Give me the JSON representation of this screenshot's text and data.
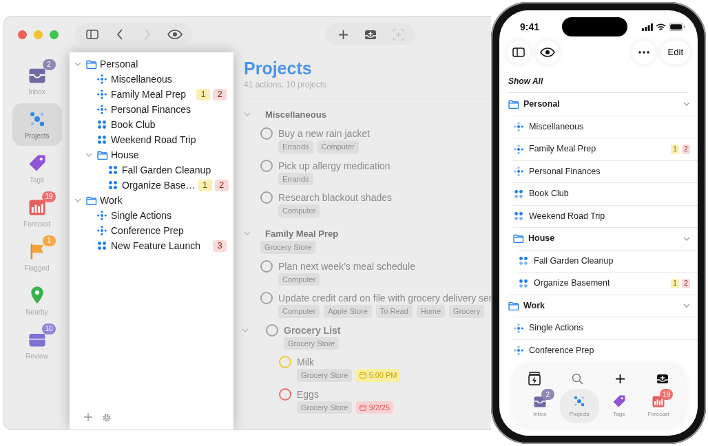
{
  "mac_window": {
    "toolbar": [
      {
        "kind": "sidebar",
        "disabled": false
      },
      {
        "kind": "back",
        "disabled": false
      },
      {
        "kind": "forward",
        "disabled": true
      },
      {
        "kind": "eye",
        "disabled": false
      },
      {
        "kind": "add",
        "disabled": false
      },
      {
        "kind": "inbox_add",
        "disabled": false
      },
      {
        "kind": "capture",
        "disabled": true
      }
    ],
    "rail": [
      {
        "kind": "inbox",
        "label": "Inbox",
        "badge": "2",
        "selected": false
      },
      {
        "kind": "projects",
        "label": "Projects",
        "selected": true
      },
      {
        "kind": "tags",
        "label": "Tags",
        "selected": false
      },
      {
        "kind": "forecast",
        "label": "Forecast",
        "badge": "19",
        "selected": false
      },
      {
        "kind": "flagged",
        "label": "Flagged",
        "badge": "1",
        "selected": false
      },
      {
        "kind": "nearby",
        "label": "Nearby",
        "selected": false
      },
      {
        "kind": "review",
        "label": "Review",
        "badge": "10",
        "selected": false
      }
    ],
    "sidebar": {
      "tree": [
        {
          "kind": "folder",
          "name": "Personal",
          "expanded": true,
          "children": [
            {
              "kind": "cross",
              "name": "Miscellaneous"
            },
            {
              "kind": "cross",
              "name": "Family Meal Prep",
              "due_soon": "1",
              "overdue": "2"
            },
            {
              "kind": "cross",
              "name": "Personal Finances"
            },
            {
              "kind": "grid",
              "name": "Book Club"
            },
            {
              "kind": "grid",
              "name": "Weekend Road Trip"
            },
            {
              "kind": "folder",
              "name": "House",
              "expanded": true,
              "children": [
                {
                  "kind": "grid",
                  "name": "Fall Garden Cleanup"
                },
                {
                  "kind": "grid",
                  "name": "Organize Base…",
                  "due_soon": "1",
                  "overdue": "2"
                }
              ]
            }
          ]
        },
        {
          "kind": "folder",
          "name": "Work",
          "expanded": true,
          "children": [
            {
              "kind": "cross",
              "name": "Single Actions"
            },
            {
              "kind": "cross",
              "name": "Conference Prep"
            },
            {
              "kind": "grid",
              "name": "New Feature Launch",
              "overdue": "3"
            }
          ]
        }
      ]
    },
    "main": {
      "title": "Projects",
      "subtitle": "41 actions, 10 projects",
      "sections": [
        {
          "title": "Miscellaneous",
          "expanded": true,
          "actions": [
            {
              "kind": "action",
              "title": "Buy a new rain jacket",
              "due_soon": false,
              "overdue": false,
              "tags": [
                "Errands",
                "Computer"
              ]
            },
            {
              "kind": "action",
              "title": "Pick up allergy medication",
              "due_soon": false,
              "overdue": false,
              "tags": [
                "Errands"
              ]
            },
            {
              "kind": "action",
              "title": "Research blackout shades",
              "due_soon": false,
              "overdue": false,
              "tags": [
                "Computer"
              ]
            }
          ]
        },
        {
          "title": "Family Meal Prep",
          "expanded": true,
          "tags": [
            "Grocery Store"
          ],
          "actions": [
            {
              "kind": "action",
              "title": "Plan next week’s meal schedule",
              "due_soon": false,
              "overdue": false,
              "tags": [
                "Computer"
              ]
            },
            {
              "kind": "action",
              "title": "Update credit card on file with grocery delivery ser",
              "due_soon": false,
              "overdue": false,
              "tags": [
                "Computer",
                "Apple Store",
                "To Read",
                "Home",
                "Grocery"
              ]
            },
            {
              "kind": "group",
              "title": "Grocery List",
              "due_soon": false,
              "overdue": false,
              "expanded": true,
              "tags": [
                "Grocery Store"
              ],
              "children": [
                {
                  "kind": "action",
                  "title": "Milk",
                  "due_soon": true,
                  "overdue": false,
                  "tags": [
                    "Grocery Store"
                  ],
                  "due": "5:00 PM"
                },
                {
                  "kind": "action",
                  "title": "Eggs",
                  "due_soon": false,
                  "overdue": true,
                  "tags": [
                    "Grocery Store"
                  ],
                  "due": "9/2/25"
                }
              ]
            }
          ]
        }
      ]
    }
  },
  "phone": {
    "status_time": "9:41",
    "edit_label": "Edit",
    "show_all": "Show All",
    "tree": [
      {
        "kind": "folder",
        "name": "Personal",
        "expanded": true,
        "children": [
          {
            "kind": "cross",
            "name": "Miscellaneous"
          },
          {
            "kind": "cross",
            "name": "Family Meal Prep",
            "due_soon": "1",
            "overdue": "2"
          },
          {
            "kind": "cross",
            "name": "Personal Finances"
          },
          {
            "kind": "grid",
            "name": "Book Club"
          },
          {
            "kind": "grid",
            "name": "Weekend Road Trip"
          },
          {
            "kind": "folder",
            "name": "House",
            "expanded": true,
            "children": [
              {
                "kind": "grid",
                "name": "Fall Garden Cleanup"
              },
              {
                "kind": "grid",
                "name": "Organize Basement",
                "due_soon": "1",
                "overdue": "2"
              }
            ]
          }
        ]
      },
      {
        "kind": "folder",
        "name": "Work",
        "expanded": true,
        "children": [
          {
            "kind": "cross",
            "name": "Single Actions"
          },
          {
            "kind": "cross",
            "name": "Conference Prep"
          }
        ]
      }
    ],
    "actions": [
      {
        "kind": "quick_entry"
      },
      {
        "kind": "search"
      },
      {
        "kind": "add"
      },
      {
        "kind": "inbox_add"
      }
    ],
    "tabs": [
      {
        "kind": "inbox",
        "label": "Inbox",
        "badge": "2",
        "selected": false
      },
      {
        "kind": "projects",
        "label": "Projects",
        "selected": true
      },
      {
        "kind": "tags",
        "label": "Tags",
        "selected": false
      },
      {
        "kind": "forecast",
        "label": "Forecast",
        "badge": "19",
        "selected": false
      }
    ]
  }
}
